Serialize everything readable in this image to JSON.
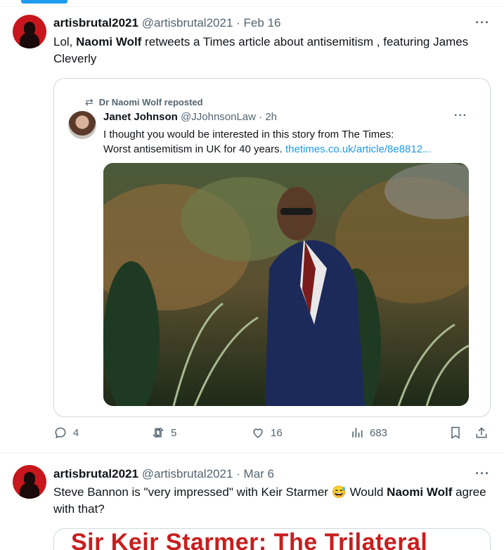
{
  "post1": {
    "name": "artisbrutal2021",
    "handle": "@artisbrutal2021",
    "separator": "·",
    "date": "Feb 16",
    "more": "···",
    "text_parts": [
      "Lol, ",
      "Naomi Wolf",
      " retweets a Times article about antisemitism , featuring James Cleverly"
    ],
    "quote": {
      "repost_label": "Dr Naomi Wolf reposted",
      "name": "Janet Johnson",
      "handle": "@JJohnsonLaw",
      "separator": "·",
      "time": "2h",
      "more": "···",
      "line1": "I thought you would be interested in this story from The Times:",
      "line2": "Worst antisemitism in UK for 40 years.",
      "link": "thetimes.co.uk/article/8e8812..."
    },
    "actions": {
      "replies": "4",
      "reposts": "5",
      "likes": "16",
      "views": "683"
    }
  },
  "post2": {
    "name": "artisbrutal2021",
    "handle": "@artisbrutal2021",
    "separator": "·",
    "date": "Mar 6",
    "more": "···",
    "text_parts": [
      "Steve Bannon is \"very impressed\" with Keir Starmer ",
      "😅",
      " Would ",
      "Naomi Wolf",
      " agree with that?"
    ],
    "card_title": "Sir Keir Starmer: The Trilateral"
  }
}
